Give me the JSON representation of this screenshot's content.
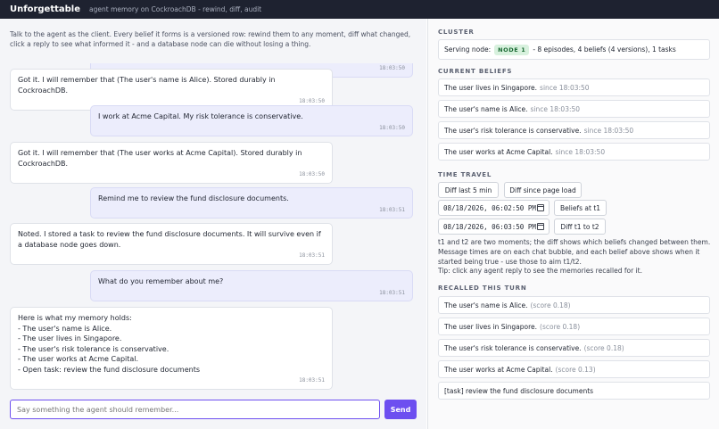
{
  "header": {
    "brand": "Unforgettable",
    "tagline": "agent memory on CockroachDB - rewind, diff, audit"
  },
  "intro": "Talk to the agent as the client. Every belief it forms is a versioned row: rewind them to any moment, diff what changed, click a reply to see what informed it - and a database node can die without losing a thing.",
  "messages": [
    {
      "role": "user",
      "text": "",
      "time": "18:03:50"
    },
    {
      "role": "agent",
      "text": "Got it. I will remember that (The user's name is Alice). Stored durably in CockroachDB.",
      "time": "18:03:50"
    },
    {
      "role": "user",
      "text": "I work at Acme Capital. My risk tolerance is conservative.",
      "time": "18:03:50"
    },
    {
      "role": "agent",
      "text": "Got it. I will remember that (The user works at Acme Capital). Stored durably in CockroachDB.",
      "time": "18:03:50"
    },
    {
      "role": "user",
      "text": "Remind me to review the fund disclosure documents.",
      "time": "18:03:51"
    },
    {
      "role": "agent",
      "text": "Noted. I stored a task to review the fund disclosure documents. It will survive even if a database node goes down.",
      "time": "18:03:51"
    },
    {
      "role": "user",
      "text": "What do you remember about me?",
      "time": "18:03:51"
    },
    {
      "role": "agent",
      "text": "Here is what my memory holds:\n- The user's name is Alice.\n- The user lives in Singapore.\n- The user's risk tolerance is conservative.\n- The user works at Acme Capital.\n- Open task: review the fund disclosure documents",
      "time": "18:03:51"
    }
  ],
  "composer": {
    "placeholder": "Say something the agent should remember...",
    "send_label": "Send"
  },
  "cluster": {
    "heading": "CLUSTER",
    "serving_label": "Serving node:",
    "node_badge": "NODE 1",
    "summary": "- 8 episodes, 4 beliefs (4 versions), 1 tasks"
  },
  "beliefs": {
    "heading": "CURRENT BELIEFS",
    "items": [
      {
        "text": "The user lives in Singapore.",
        "meta": "since 18:03:50"
      },
      {
        "text": "The user's name is Alice.",
        "meta": "since 18:03:50"
      },
      {
        "text": "The user's risk tolerance is conservative.",
        "meta": "since 18:03:50"
      },
      {
        "text": "The user works at Acme Capital.",
        "meta": "since 18:03:50"
      }
    ]
  },
  "time_travel": {
    "heading": "TIME TRAVEL",
    "diff_last_label": "Diff last 5 min",
    "diff_since_load_label": "Diff since page load",
    "t1_value": "08/18/2026, 06:02:50 PM",
    "t2_value": "08/18/2026, 06:03:50 PM",
    "beliefs_at_t1_label": "Beliefs at t1",
    "diff_t1_t2_label": "Diff t1 to t2",
    "help": "t1 and t2 are two moments; the diff shows which beliefs changed between them. Message times are on each chat bubble, and each belief above shows when it started being true - use those to aim t1/t2.",
    "tip": "Tip: click any agent reply to see the memories recalled for it."
  },
  "recalled": {
    "heading": "RECALLED THIS TURN",
    "items": [
      {
        "text": "The user's name is Alice.",
        "meta": "(score 0.18)"
      },
      {
        "text": "The user lives in Singapore.",
        "meta": "(score 0.18)"
      },
      {
        "text": "The user's risk tolerance is conservative.",
        "meta": "(score 0.18)"
      },
      {
        "text": "The user works at Acme Capital.",
        "meta": "(score 0.13)"
      },
      {
        "text": "[task] review the fund disclosure documents",
        "meta": ""
      }
    ]
  }
}
